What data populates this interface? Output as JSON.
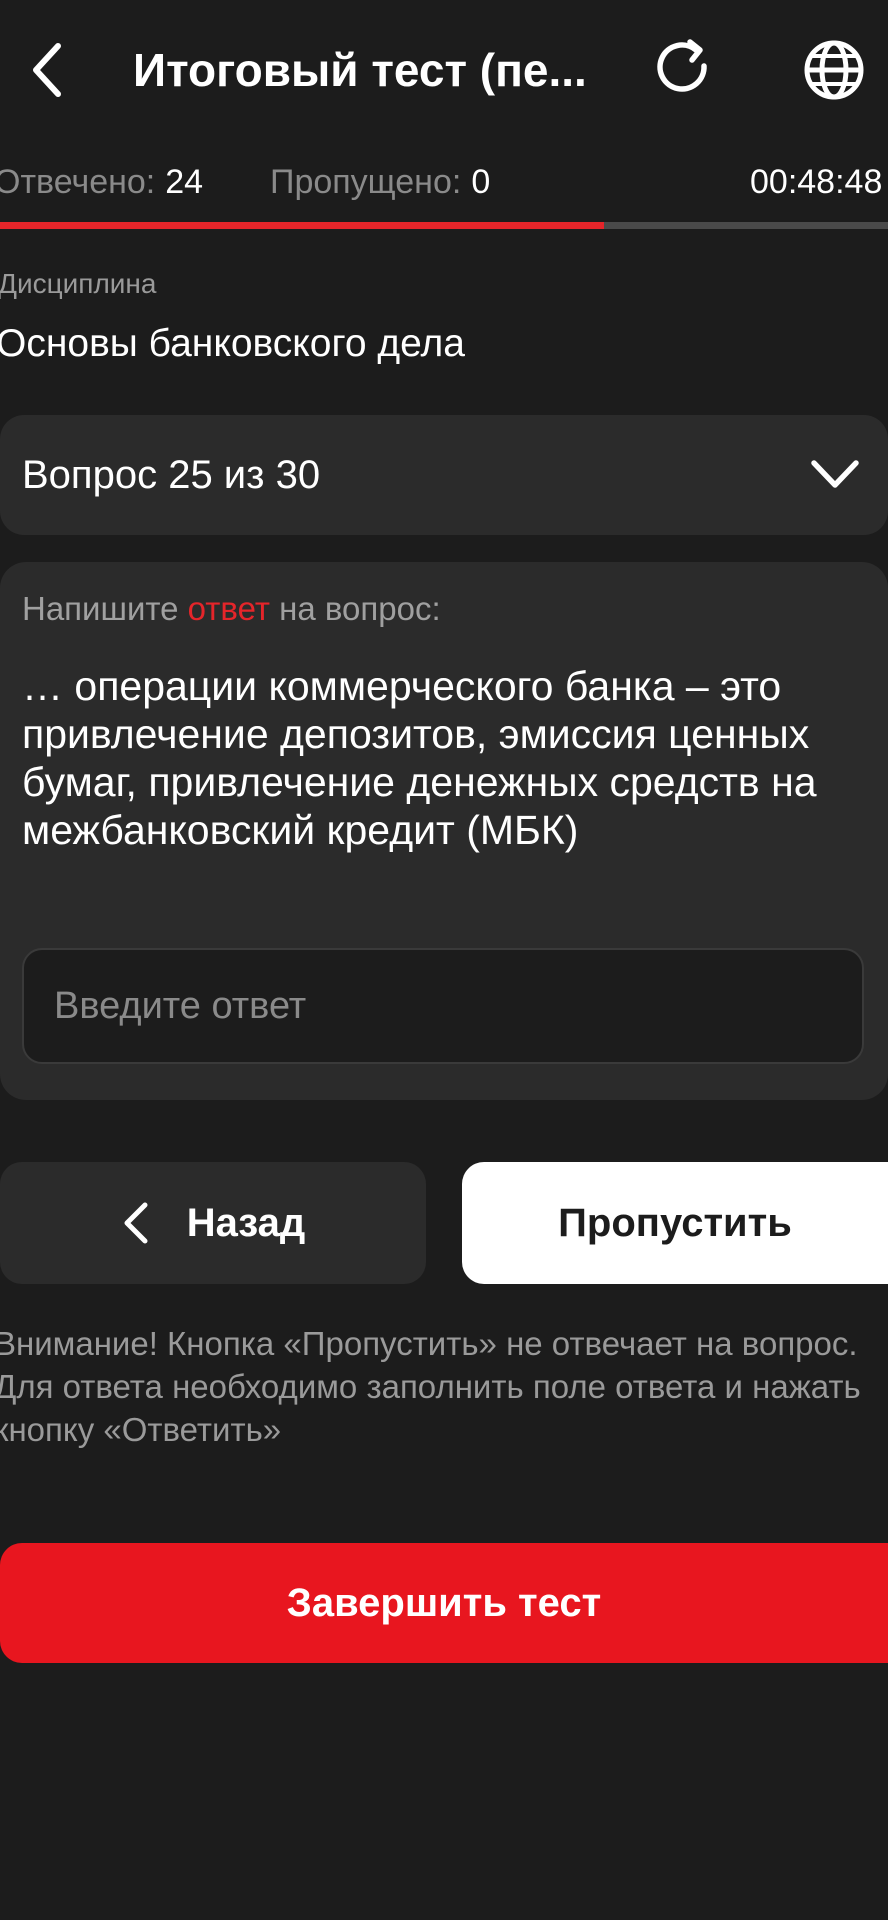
{
  "header": {
    "title": "Итоговый тест (пе...",
    "back_icon": "chevron-left-icon",
    "refresh_icon": "refresh-icon",
    "language_icon": "globe-icon"
  },
  "stats": {
    "answered_label": "Отвечено:",
    "answered_value": "24",
    "skipped_label": "Пропущено:",
    "skipped_value": "0",
    "timer": "00:48:48"
  },
  "progress": {
    "fraction": 0.68,
    "fill_color": "#e5252a",
    "track_color": "#4a4a4a"
  },
  "discipline": {
    "label": "Дисциплина",
    "value": "Основы банковского дела"
  },
  "question_selector": {
    "label": "Вопрос 25 из 30",
    "icon": "chevron-down-icon"
  },
  "question_card": {
    "prompt_before": "Напишите ",
    "prompt_accent": "ответ",
    "prompt_after": " на вопрос:",
    "question_text": "… операции коммерческого банка – это привлечение депозитов, эмиссия ценных бумаг, привлечение денежных средств на межбанковский кредит (МБК)",
    "answer_placeholder": "Введите ответ",
    "answer_value": ""
  },
  "buttons": {
    "back_label": "Назад",
    "skip_label": "Пропустить",
    "finish_label": "Завершить тест"
  },
  "notice": "Внимание! Кнопка «Пропустить» не отвечает на вопрос. Для ответа необходимо заполнить поле ответа и нажать кнопку «Ответить»",
  "colors": {
    "background": "#1c1c1c",
    "card": "#2b2b2b",
    "accent_red": "#e8161f",
    "muted_text": "#9a9a9a"
  }
}
